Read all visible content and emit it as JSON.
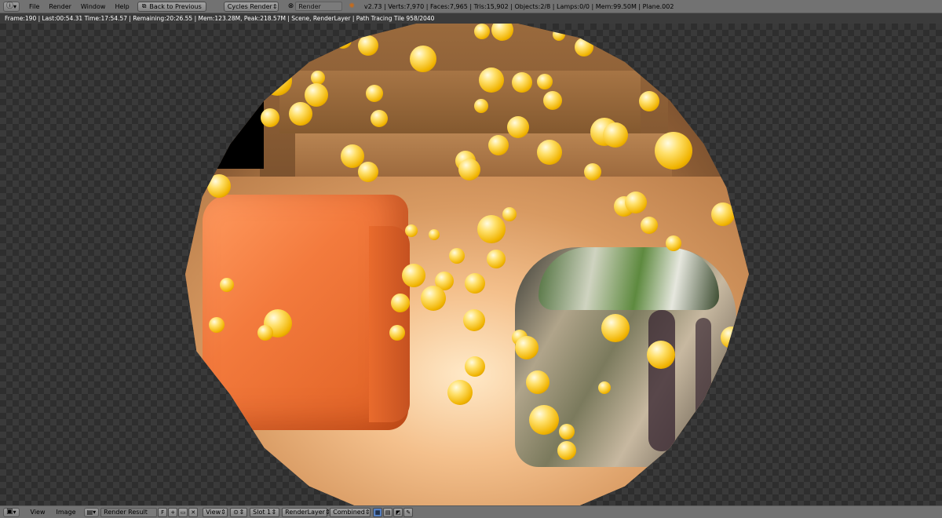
{
  "header": {
    "menus": [
      "File",
      "Render",
      "Window",
      "Help"
    ],
    "back_button": "Back to Previous",
    "engine": "Cycles Render",
    "scene_field": "Render",
    "stats": "v2.73 | Verts:7,970 | Faces:7,965 | Tris:15,902 | Objects:2/8 | Lamps:0/0 | Mem:99.50M | Plane.002"
  },
  "info": {
    "text": "Frame:190 | Last:00:54.31 Time:17:54.57 | Remaining:20:26.55 | Mem:123.28M, Peak:218.57M | Scene, RenderLayer | Path Tracing Tile 958/2040"
  },
  "footer": {
    "menus": [
      "View",
      "Image"
    ],
    "image_name": "Render Result",
    "fake_user": "F",
    "view_select": "View",
    "slot": "Slot 1",
    "layer": "RenderLayer",
    "pass": "Combined"
  },
  "icons": {
    "editor": "info-editor-icon",
    "back": "back-arrow-icon",
    "close": "close-x-icon",
    "render": "render-icon",
    "image_editor": "image-editor-icon"
  }
}
